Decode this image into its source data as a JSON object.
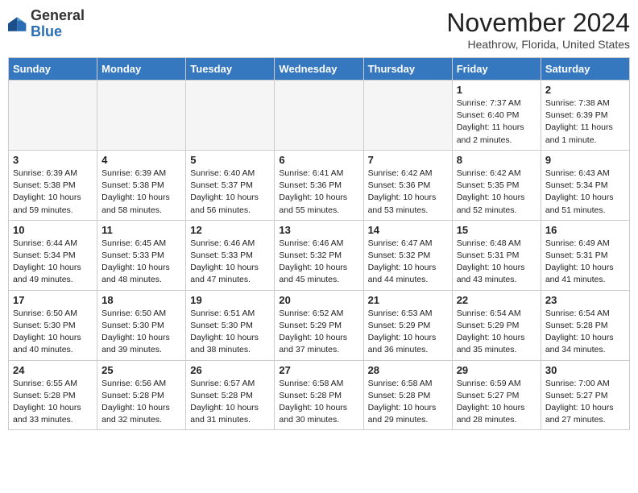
{
  "header": {
    "logo_general": "General",
    "logo_blue": "Blue",
    "month_title": "November 2024",
    "location": "Heathrow, Florida, United States"
  },
  "weekdays": [
    "Sunday",
    "Monday",
    "Tuesday",
    "Wednesday",
    "Thursday",
    "Friday",
    "Saturday"
  ],
  "weeks": [
    [
      {
        "day": "",
        "empty": true
      },
      {
        "day": "",
        "empty": true
      },
      {
        "day": "",
        "empty": true
      },
      {
        "day": "",
        "empty": true
      },
      {
        "day": "",
        "empty": true
      },
      {
        "day": "1",
        "sunrise": "Sunrise: 7:37 AM",
        "sunset": "Sunset: 6:40 PM",
        "daylight": "Daylight: 11 hours and 2 minutes."
      },
      {
        "day": "2",
        "sunrise": "Sunrise: 7:38 AM",
        "sunset": "Sunset: 6:39 PM",
        "daylight": "Daylight: 11 hours and 1 minute."
      }
    ],
    [
      {
        "day": "3",
        "sunrise": "Sunrise: 6:39 AM",
        "sunset": "Sunset: 5:38 PM",
        "daylight": "Daylight: 10 hours and 59 minutes."
      },
      {
        "day": "4",
        "sunrise": "Sunrise: 6:39 AM",
        "sunset": "Sunset: 5:38 PM",
        "daylight": "Daylight: 10 hours and 58 minutes."
      },
      {
        "day": "5",
        "sunrise": "Sunrise: 6:40 AM",
        "sunset": "Sunset: 5:37 PM",
        "daylight": "Daylight: 10 hours and 56 minutes."
      },
      {
        "day": "6",
        "sunrise": "Sunrise: 6:41 AM",
        "sunset": "Sunset: 5:36 PM",
        "daylight": "Daylight: 10 hours and 55 minutes."
      },
      {
        "day": "7",
        "sunrise": "Sunrise: 6:42 AM",
        "sunset": "Sunset: 5:36 PM",
        "daylight": "Daylight: 10 hours and 53 minutes."
      },
      {
        "day": "8",
        "sunrise": "Sunrise: 6:42 AM",
        "sunset": "Sunset: 5:35 PM",
        "daylight": "Daylight: 10 hours and 52 minutes."
      },
      {
        "day": "9",
        "sunrise": "Sunrise: 6:43 AM",
        "sunset": "Sunset: 5:34 PM",
        "daylight": "Daylight: 10 hours and 51 minutes."
      }
    ],
    [
      {
        "day": "10",
        "sunrise": "Sunrise: 6:44 AM",
        "sunset": "Sunset: 5:34 PM",
        "daylight": "Daylight: 10 hours and 49 minutes."
      },
      {
        "day": "11",
        "sunrise": "Sunrise: 6:45 AM",
        "sunset": "Sunset: 5:33 PM",
        "daylight": "Daylight: 10 hours and 48 minutes."
      },
      {
        "day": "12",
        "sunrise": "Sunrise: 6:46 AM",
        "sunset": "Sunset: 5:33 PM",
        "daylight": "Daylight: 10 hours and 47 minutes."
      },
      {
        "day": "13",
        "sunrise": "Sunrise: 6:46 AM",
        "sunset": "Sunset: 5:32 PM",
        "daylight": "Daylight: 10 hours and 45 minutes."
      },
      {
        "day": "14",
        "sunrise": "Sunrise: 6:47 AM",
        "sunset": "Sunset: 5:32 PM",
        "daylight": "Daylight: 10 hours and 44 minutes."
      },
      {
        "day": "15",
        "sunrise": "Sunrise: 6:48 AM",
        "sunset": "Sunset: 5:31 PM",
        "daylight": "Daylight: 10 hours and 43 minutes."
      },
      {
        "day": "16",
        "sunrise": "Sunrise: 6:49 AM",
        "sunset": "Sunset: 5:31 PM",
        "daylight": "Daylight: 10 hours and 41 minutes."
      }
    ],
    [
      {
        "day": "17",
        "sunrise": "Sunrise: 6:50 AM",
        "sunset": "Sunset: 5:30 PM",
        "daylight": "Daylight: 10 hours and 40 minutes."
      },
      {
        "day": "18",
        "sunrise": "Sunrise: 6:50 AM",
        "sunset": "Sunset: 5:30 PM",
        "daylight": "Daylight: 10 hours and 39 minutes."
      },
      {
        "day": "19",
        "sunrise": "Sunrise: 6:51 AM",
        "sunset": "Sunset: 5:30 PM",
        "daylight": "Daylight: 10 hours and 38 minutes."
      },
      {
        "day": "20",
        "sunrise": "Sunrise: 6:52 AM",
        "sunset": "Sunset: 5:29 PM",
        "daylight": "Daylight: 10 hours and 37 minutes."
      },
      {
        "day": "21",
        "sunrise": "Sunrise: 6:53 AM",
        "sunset": "Sunset: 5:29 PM",
        "daylight": "Daylight: 10 hours and 36 minutes."
      },
      {
        "day": "22",
        "sunrise": "Sunrise: 6:54 AM",
        "sunset": "Sunset: 5:29 PM",
        "daylight": "Daylight: 10 hours and 35 minutes."
      },
      {
        "day": "23",
        "sunrise": "Sunrise: 6:54 AM",
        "sunset": "Sunset: 5:28 PM",
        "daylight": "Daylight: 10 hours and 34 minutes."
      }
    ],
    [
      {
        "day": "24",
        "sunrise": "Sunrise: 6:55 AM",
        "sunset": "Sunset: 5:28 PM",
        "daylight": "Daylight: 10 hours and 33 minutes."
      },
      {
        "day": "25",
        "sunrise": "Sunrise: 6:56 AM",
        "sunset": "Sunset: 5:28 PM",
        "daylight": "Daylight: 10 hours and 32 minutes."
      },
      {
        "day": "26",
        "sunrise": "Sunrise: 6:57 AM",
        "sunset": "Sunset: 5:28 PM",
        "daylight": "Daylight: 10 hours and 31 minutes."
      },
      {
        "day": "27",
        "sunrise": "Sunrise: 6:58 AM",
        "sunset": "Sunset: 5:28 PM",
        "daylight": "Daylight: 10 hours and 30 minutes."
      },
      {
        "day": "28",
        "sunrise": "Sunrise: 6:58 AM",
        "sunset": "Sunset: 5:28 PM",
        "daylight": "Daylight: 10 hours and 29 minutes."
      },
      {
        "day": "29",
        "sunrise": "Sunrise: 6:59 AM",
        "sunset": "Sunset: 5:27 PM",
        "daylight": "Daylight: 10 hours and 28 minutes."
      },
      {
        "day": "30",
        "sunrise": "Sunrise: 7:00 AM",
        "sunset": "Sunset: 5:27 PM",
        "daylight": "Daylight: 10 hours and 27 minutes."
      }
    ]
  ]
}
